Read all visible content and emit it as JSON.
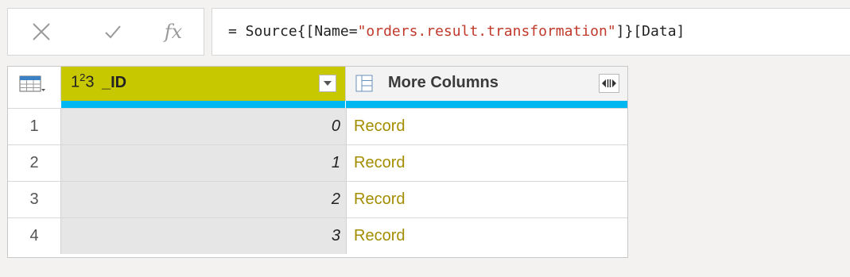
{
  "formula_bar": {
    "cancel_icon": "x-icon",
    "confirm_icon": "check-icon",
    "fx_label": "fx",
    "formula_prefix": "= Source{[Name=",
    "formula_string": "\"orders.result.transformation\"",
    "formula_suffix": "]}[Data]"
  },
  "grid": {
    "columns": [
      {
        "type_prefix": "1",
        "type_sup": "2",
        "type_suffix": "3",
        "name": "_ID",
        "header_color": "#c8c800"
      },
      {
        "name": "More Columns"
      }
    ],
    "rows": [
      {
        "num": "1",
        "id": "0",
        "value": "Record"
      },
      {
        "num": "2",
        "id": "1",
        "value": "Record"
      },
      {
        "num": "3",
        "id": "2",
        "value": "Record"
      },
      {
        "num": "4",
        "id": "3",
        "value": "Record"
      }
    ],
    "record_color": "#a38d00",
    "quality_bar_color": "#00b7f1"
  }
}
